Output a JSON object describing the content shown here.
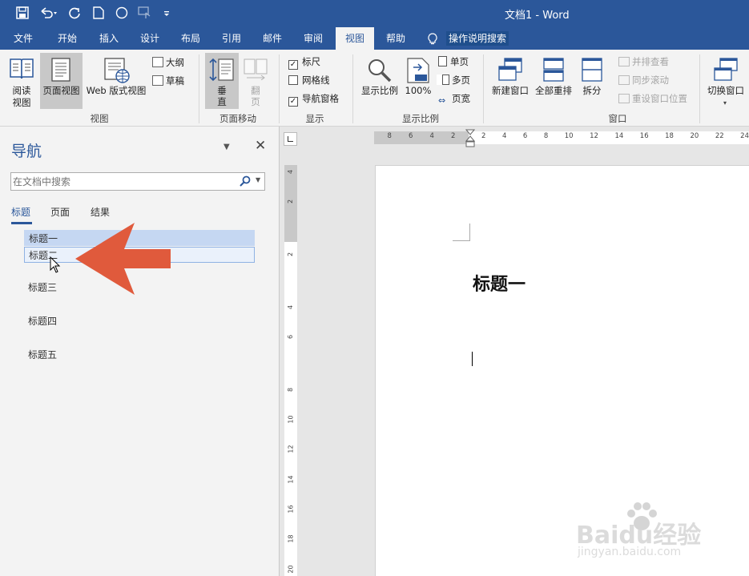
{
  "titlebar": {
    "title": "文档1 - Word"
  },
  "tabs": [
    {
      "label": "文件"
    },
    {
      "label": "开始"
    },
    {
      "label": "插入"
    },
    {
      "label": "设计"
    },
    {
      "label": "布局"
    },
    {
      "label": "引用"
    },
    {
      "label": "邮件"
    },
    {
      "label": "审阅"
    },
    {
      "label": "视图"
    },
    {
      "label": "帮助"
    }
  ],
  "tell_me": {
    "label": "操作说明搜索"
  },
  "ribbon": {
    "view_group": {
      "label": "视图",
      "read_mode": "阅读\n视图",
      "print_layout": "页面视图",
      "web_layout": "Web 版式视图",
      "outline": "大纲",
      "draft": "草稿"
    },
    "page_move": {
      "label": "页面移动",
      "vertical": "垂\n直",
      "side": "翻\n页"
    },
    "show": {
      "label": "显示",
      "ruler": "标尺",
      "gridlines": "网格线",
      "nav_pane": "导航窗格",
      "ruler_checked": true,
      "gridlines_checked": false,
      "nav_pane_checked": true
    },
    "zoom": {
      "label": "显示比例",
      "zoom": "显示比例",
      "hundred": "100%",
      "one_page": "单页",
      "multi_page": "多页",
      "page_width": "页宽"
    },
    "window": {
      "label": "窗口",
      "new_window": "新建窗口",
      "arrange_all": "全部重排",
      "split": "拆分",
      "side_by_side": "并排查看",
      "sync_scroll": "同步滚动",
      "reset_pos": "重设窗口位置",
      "switch": "切换窗口"
    }
  },
  "nav": {
    "title": "导航",
    "search_placeholder": "在文档中搜索",
    "tabs": [
      {
        "label": "标题"
      },
      {
        "label": "页面"
      },
      {
        "label": "结果"
      }
    ],
    "headings": [
      {
        "label": "标题一"
      },
      {
        "label": "标题二"
      },
      {
        "label": "标题三"
      },
      {
        "label": "标题四"
      },
      {
        "label": "标题五"
      }
    ]
  },
  "ruler": {
    "h_left": [
      "8",
      "6",
      "4",
      "2"
    ],
    "h_right": [
      "2",
      "4",
      "6",
      "8",
      "10",
      "12",
      "14",
      "16",
      "18",
      "20",
      "22",
      "24"
    ],
    "v": [
      "4",
      "2",
      "",
      "2",
      "",
      "4",
      "6",
      "",
      "8",
      "10",
      "12",
      "14",
      "16",
      "18",
      "20"
    ]
  },
  "document": {
    "heading": "标题一"
  },
  "watermark": {
    "text": "Baidu经验",
    "sub": "jingyan.baidu.com"
  }
}
